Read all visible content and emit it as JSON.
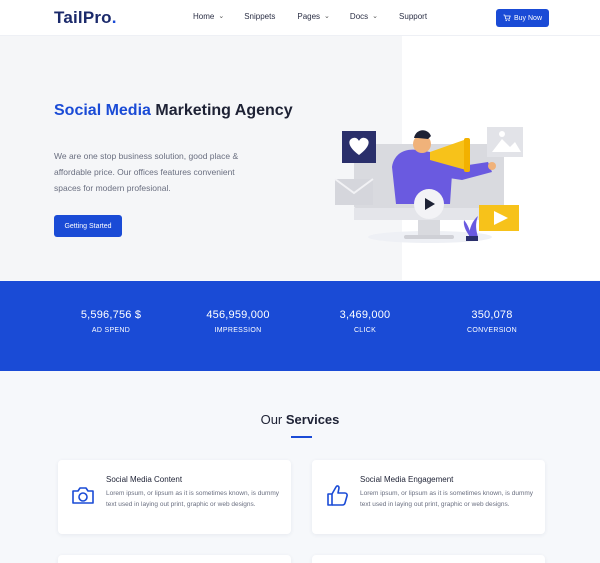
{
  "header": {
    "logo_main": "TailPro",
    "logo_dot": ".",
    "nav": [
      {
        "label": "Home",
        "has_dropdown": true
      },
      {
        "label": "Snippets",
        "has_dropdown": false
      },
      {
        "label": "Pages",
        "has_dropdown": true
      },
      {
        "label": "Docs",
        "has_dropdown": true
      },
      {
        "label": "Support",
        "has_dropdown": false
      }
    ],
    "buy_label": "Buy Now",
    "buy_icon": "cart-icon"
  },
  "hero": {
    "title_accent": "Social Media",
    "title_rest": "Marketing Agency",
    "text": "We are one stop business solution, good place & affordable price. Our offices features convenient spaces for modern profesional.",
    "cta_label": "Getting Started"
  },
  "stats": [
    {
      "value": "5,596,756 $",
      "label": "AD SPEND"
    },
    {
      "value": "456,959,000",
      "label": "IMPRESSION"
    },
    {
      "value": "3,469,000",
      "label": "CLICK"
    },
    {
      "value": "350,078",
      "label": "CONVERSION"
    }
  ],
  "services": {
    "title_light": "Our",
    "title_strong": "Services",
    "cards": [
      {
        "title": "Social Media Content",
        "text": "Lorem ipsum, or lipsum as it is sometimes known, is dummy text used in laying out print, graphic or web designs.",
        "icon": "camera-icon"
      },
      {
        "title": "Social Media Engagement",
        "text": "Lorem ipsum, or lipsum as it is sometimes known, is dummy text used in laying out print, graphic or web designs.",
        "icon": "thumbs-up-icon"
      }
    ]
  },
  "colors": {
    "accent": "#1a4bd6",
    "heading": "#1e2235",
    "muted": "#6a6f80",
    "illustration_yellow": "#f7c21a",
    "illustration_purple": "#6a5ae0",
    "illustration_navy": "#2a2f6b"
  }
}
